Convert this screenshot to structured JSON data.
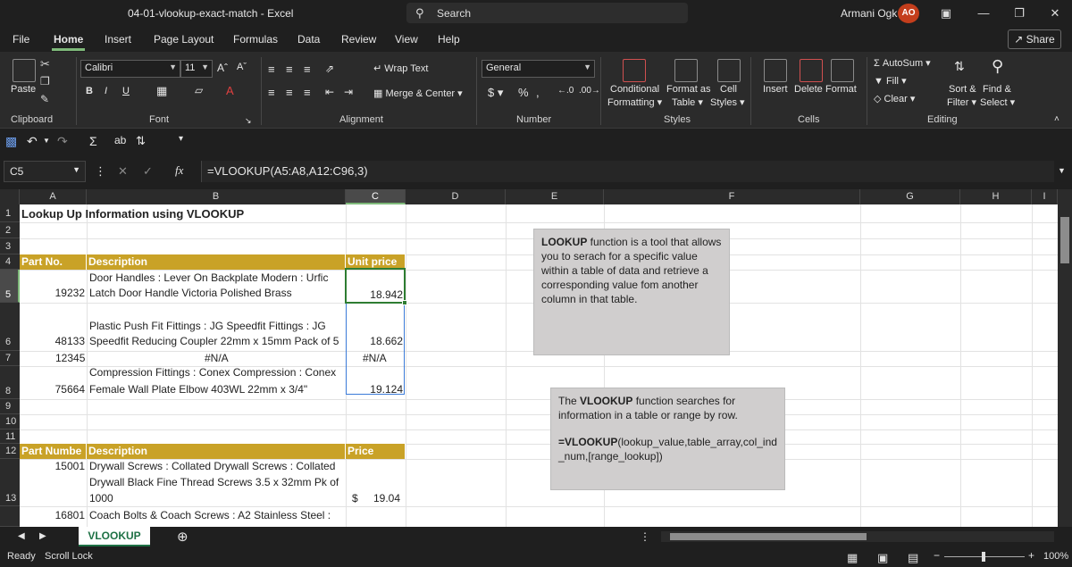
{
  "window": {
    "title": "04-01-vlookup-exact-match  -  Excel",
    "search_placeholder": "Search",
    "user_name": "Armani Ogk",
    "user_initials": "AO"
  },
  "menu": {
    "tabs": [
      "File",
      "Home",
      "Insert",
      "Page Layout",
      "Formulas",
      "Data",
      "Review",
      "View",
      "Help"
    ],
    "active": "Home",
    "share_label": "Share"
  },
  "ribbon": {
    "clipboard": {
      "paste_label": "Paste",
      "group_label": "Clipboard"
    },
    "font": {
      "font_name": "Calibri",
      "font_size": "11",
      "group_label": "Font",
      "bold": "B",
      "italic": "I",
      "underline": "U"
    },
    "alignment": {
      "wrap_text": "Wrap Text",
      "merge_center": "Merge & Center",
      "group_label": "Alignment"
    },
    "number": {
      "format": "General",
      "group_label": "Number"
    },
    "styles": {
      "conditional": "Conditional",
      "conditional2": "Formatting",
      "format_as": "Format as",
      "table": "Table",
      "cell": "Cell",
      "styles": "Styles",
      "group_label": "Styles"
    },
    "cells": {
      "insert": "Insert",
      "delete": "Delete",
      "format": "Format",
      "group_label": "Cells"
    },
    "editing": {
      "autosum": "AutoSum",
      "fill": "Fill",
      "clear": "Clear",
      "sort": "Sort &",
      "filter": "Filter",
      "find": "Find &",
      "select": "Select",
      "group_label": "Editing"
    }
  },
  "formula_bar": {
    "name_box": "C5",
    "fx": "fx",
    "formula": "=VLOOKUP(A5:A8,A12:C96,3)"
  },
  "columns": [
    "A",
    "B",
    "C",
    "D",
    "E",
    "F",
    "G",
    "H",
    "I"
  ],
  "rows": [
    "1",
    "2",
    "3",
    "4",
    "5",
    "6",
    "7",
    "8",
    "9",
    "10",
    "11",
    "12",
    "13"
  ],
  "sheet": {
    "title": "Lookup Up Information using VLOOKUP",
    "table1_headers": [
      "Part No.",
      "Description",
      "Unit price"
    ],
    "row5": {
      "part": "19232",
      "desc_line1": "Door Handles : Lever On Backplate Modern : Urfic",
      "desc_line2": "Latch Door Handle Victoria Polished Brass",
      "price": "18.942"
    },
    "row6": {
      "part": "48133",
      "desc_line1": "Plastic Push Fit Fittings : JG Speedfit Fittings : JG",
      "desc_line2": "Speedfit Reducing Coupler 22mm x 15mm Pack of 5",
      "price": "18.662"
    },
    "row7": {
      "part": "12345",
      "desc": "#N/A",
      "price": "#N/A"
    },
    "row8": {
      "part": "75664",
      "desc_line1": "Compression Fittings : Conex Compression : Conex",
      "desc_line2": "Female Wall Plate Elbow 403WL 22mm x 3/4\"",
      "price": "19.124"
    },
    "table2_headers": [
      "Part Numbe",
      "Description",
      "Price"
    ],
    "row13": {
      "part": "15001",
      "desc_line1": "Drywall Screws : Collated Drywall Screws : Collated",
      "desc_line2": "Drywall Black Fine Thread Screws 3.5 x 32mm Pk of",
      "desc_line3": "1000",
      "currency": "$",
      "price": "19.04"
    },
    "row14": {
      "part": "16801",
      "desc_line1": "Coach Bolts & Coach Screws : A2 Stainless Steel :"
    }
  },
  "textbox1": {
    "bold": "LOOKUP",
    "text": " function is a tool that allows you to serach for a specific value within a table of data and retrieve a corresponding value fom another column in that table."
  },
  "textbox2": {
    "pre": "The ",
    "bold": "VLOOKUP",
    "post": " function searches for information in a table or range by row.",
    "formula_bold": "=VLOOKUP",
    "formula_rest": "(lookup_value,table_array,col_ind_num,[range_lookup])"
  },
  "sheet_tab": "VLOOKUP",
  "status": {
    "ready": "Ready",
    "scroll_lock": "Scroll Lock",
    "zoom": "100%"
  },
  "colors": {
    "header_gold": "#c9a227",
    "accent_green": "#7fba7a",
    "selection_blue": "#3a7ad8"
  }
}
